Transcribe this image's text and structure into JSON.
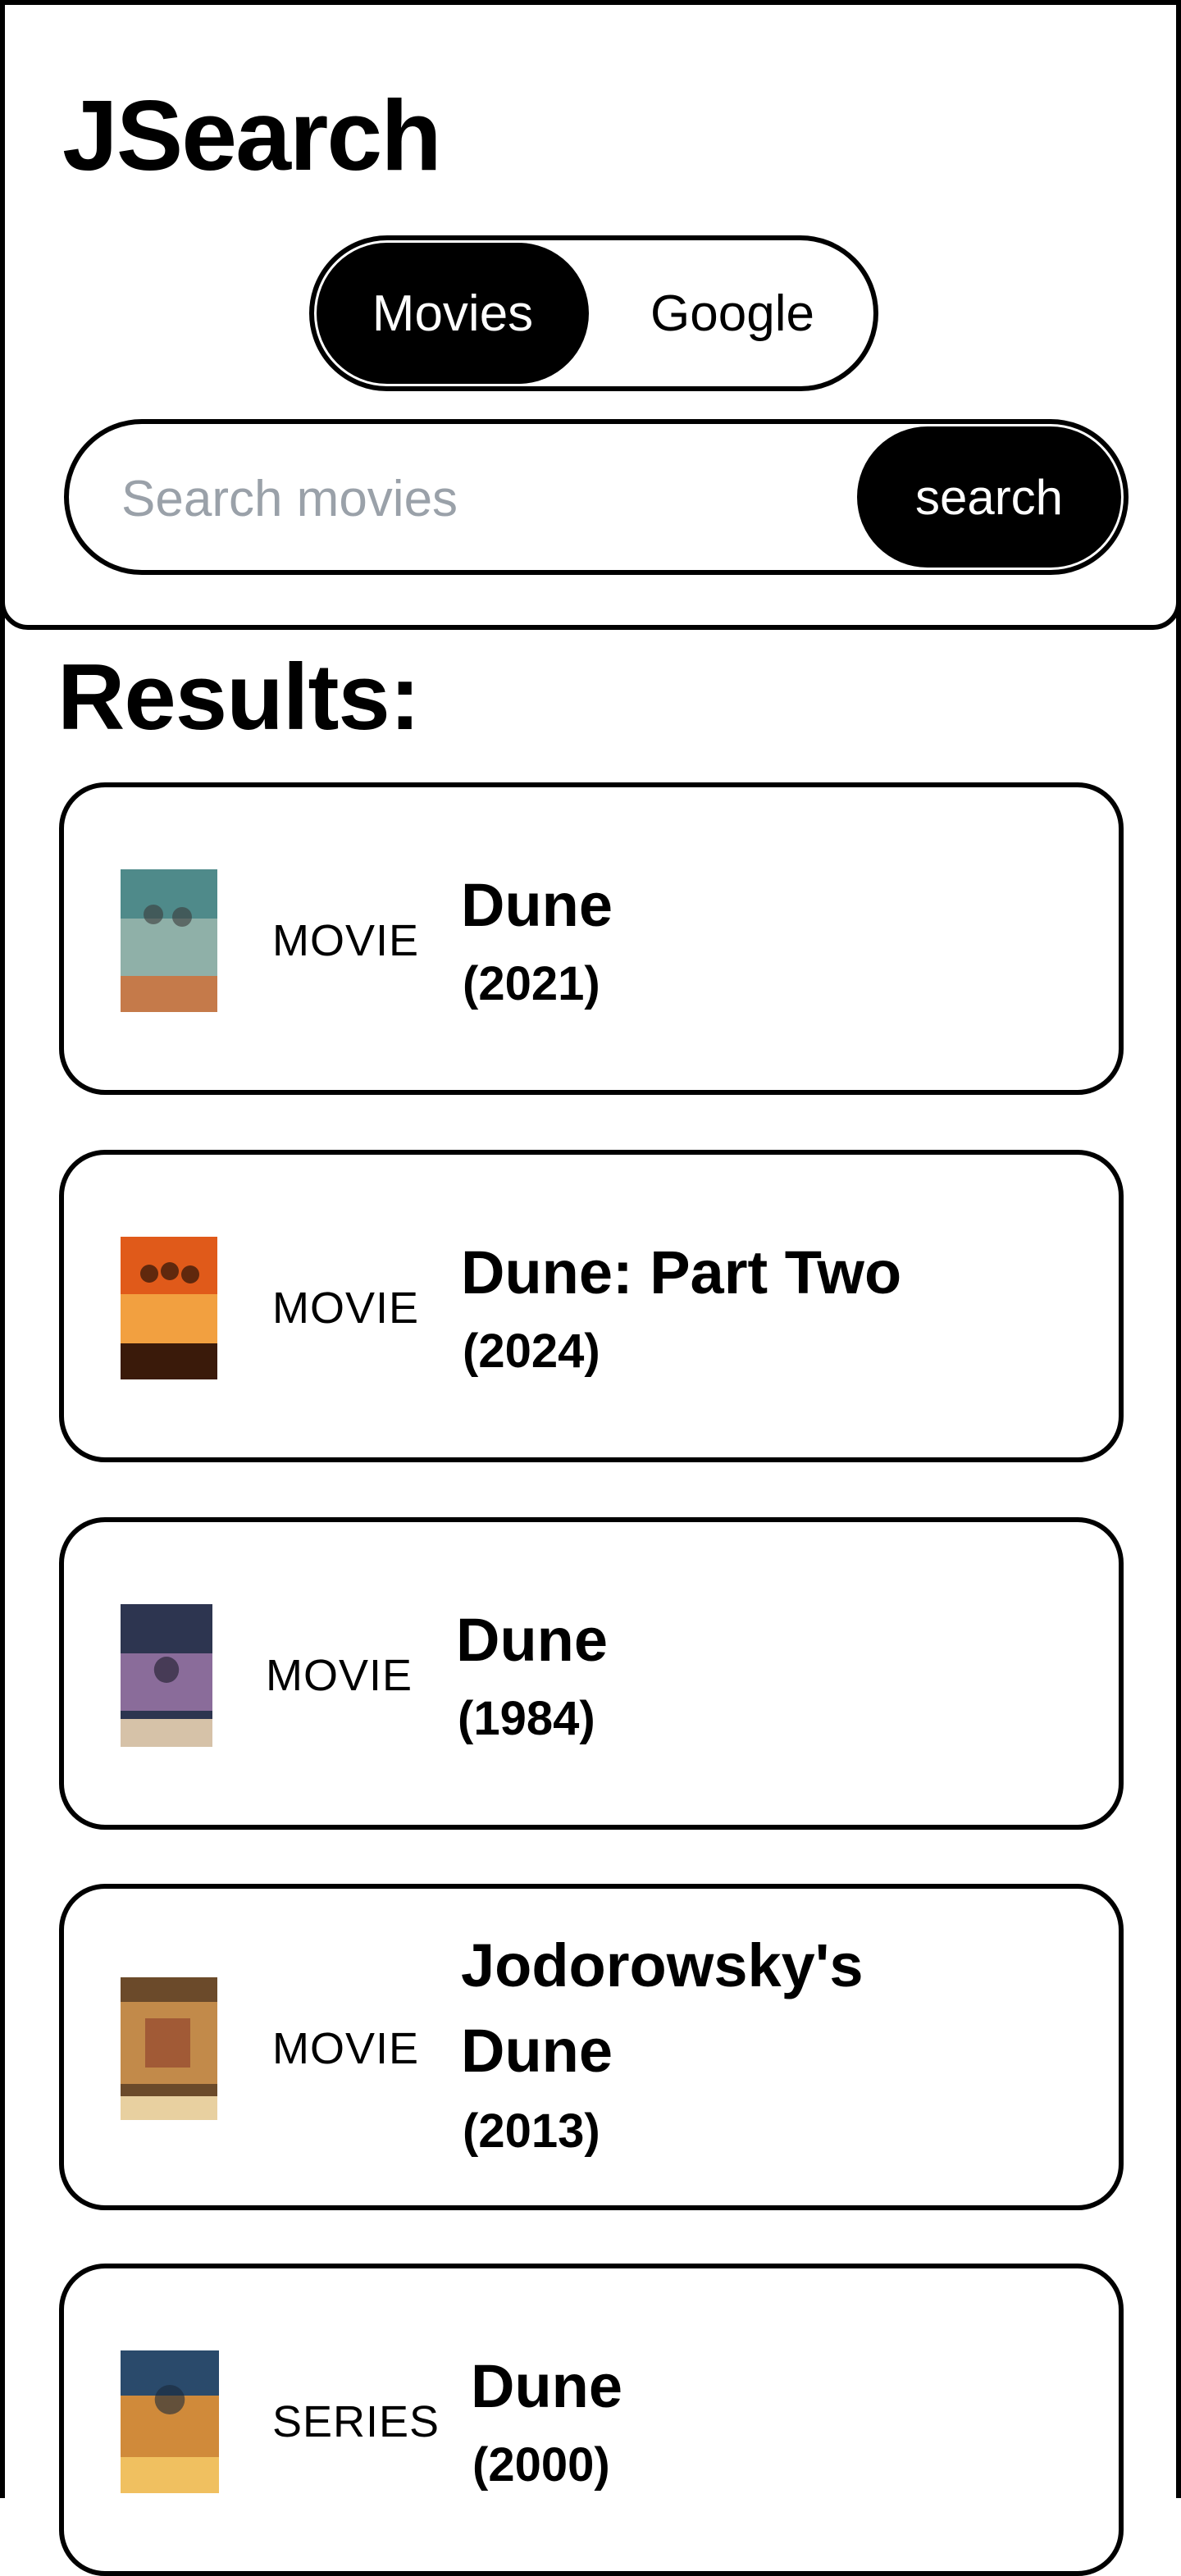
{
  "app": {
    "title": "JSearch"
  },
  "mode_toggle": {
    "options": [
      "Movies",
      "Google"
    ],
    "selected": "Movies"
  },
  "search": {
    "placeholder": "Search movies",
    "value": "",
    "button_label": "search"
  },
  "results": {
    "heading": "Results:",
    "items": [
      {
        "type": "MOVIE",
        "title": "Dune",
        "year": "(2021)",
        "poster_colors": [
          "#4f8a8a",
          "#8fb0a8",
          "#c57a4a"
        ]
      },
      {
        "type": "MOVIE",
        "title": "Dune: Part Two",
        "year": "(2024)",
        "poster_colors": [
          "#e05a1a",
          "#f2a040",
          "#3a1a0a"
        ]
      },
      {
        "type": "MOVIE",
        "title": "Dune",
        "year": "(1984)",
        "poster_colors": [
          "#2d3550",
          "#8a6c9a",
          "#d6c2a8"
        ]
      },
      {
        "type": "MOVIE",
        "title": "Jodorowsky's Dune",
        "year": "(2013)",
        "poster_colors": [
          "#6b4a2a",
          "#c28a4a",
          "#e8d0a0"
        ]
      },
      {
        "type": "SERIES",
        "title": "Dune",
        "year": "(2000)",
        "poster_colors": [
          "#2a4a6b",
          "#d08a3a",
          "#f0c060"
        ]
      }
    ]
  },
  "colors": {
    "primary": "#000000",
    "background": "#ffffff",
    "placeholder": "#9aa1a9"
  }
}
